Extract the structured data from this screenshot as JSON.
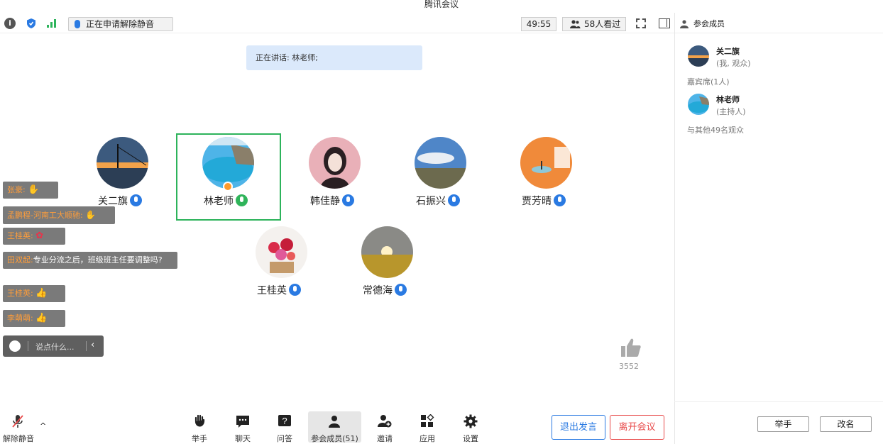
{
  "window": {
    "title": "腾讯会议"
  },
  "toolbar": {
    "unmute_request": "正在申请解除静音",
    "timer": "49:55",
    "viewers": "58人看过"
  },
  "speaking": {
    "text": "正在讲话: 林老师;"
  },
  "members": [
    {
      "name": "关二旗",
      "mic": "blue"
    },
    {
      "name": "林老师",
      "mic": "green",
      "highlighted": true,
      "host": true
    },
    {
      "name": "韩佳静",
      "mic": "blue"
    },
    {
      "name": "石振兴",
      "mic": "blue"
    },
    {
      "name": "贾芳晴",
      "mic": "blue"
    },
    {
      "name": "王桂英",
      "mic": "blue"
    },
    {
      "name": "常德海",
      "mic": "blue"
    }
  ],
  "danmu": [
    {
      "name": "张豪:",
      "text": "",
      "emoji": "clap"
    },
    {
      "name": "孟鹏程-河南工大顺驰:",
      "text": "",
      "emoji": "hand"
    },
    {
      "name": "王桂英:",
      "text": "",
      "emoji": "flower"
    },
    {
      "name": "田双起:",
      "text": "专业分流之后，班级班主任要调整吗?",
      "emoji": ""
    },
    {
      "name": "王桂英:",
      "text": "",
      "emoji": "thumb"
    },
    {
      "name": "李萌萌:",
      "text": "",
      "emoji": "thumb"
    }
  ],
  "chat": {
    "placeholder": "说点什么..."
  },
  "like": {
    "count": "3552"
  },
  "bottom": {
    "unmute": "解除静音",
    "raise_hand": "举手",
    "chat": "聊天",
    "qa": "问答",
    "members": "参会成员(51)",
    "invite": "邀请",
    "apps": "应用",
    "settings": "设置",
    "exit_speak": "退出发言",
    "leave": "离开会议"
  },
  "side": {
    "title": "参会成员",
    "me": {
      "name": "关二旗",
      "role": "(我, 观众)"
    },
    "guest_section": "嘉宾席(1人)",
    "host": {
      "name": "林老师",
      "role": "(主持人)"
    },
    "audience_section": "与其他49名观众",
    "raise_hand_btn": "举手",
    "rename_btn": "改名"
  },
  "colors": {
    "accent": "#2a7ae2",
    "highlight": "#2db35b",
    "danger": "#e84a4a",
    "danmu_name": "#ff9d3a"
  }
}
